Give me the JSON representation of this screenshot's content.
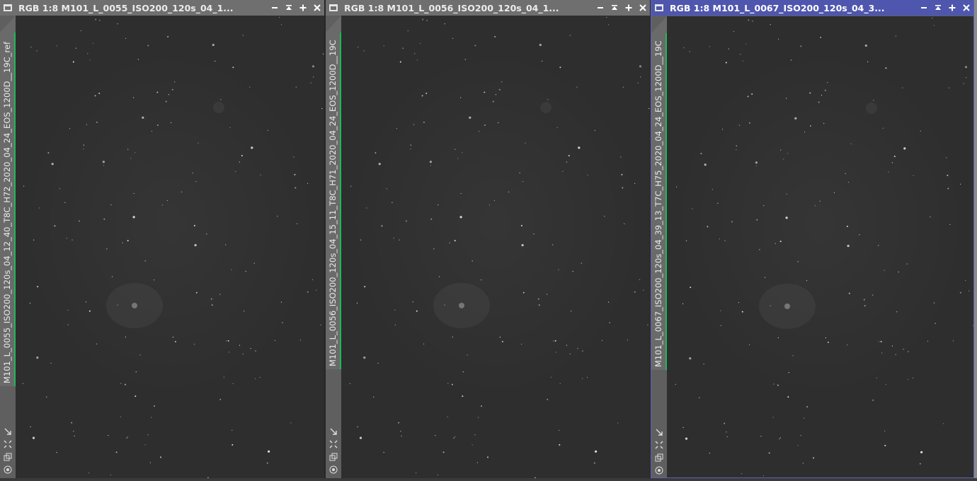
{
  "windows": [
    {
      "title": "RGB 1:8 M101_L_0055_ISO200_120s_04_1...",
      "side_label": "M101_L_0055_ISO200_120s_04_12_40_T8C_H72_2020_04_24_EOS_1200D__19C_ref",
      "active": false
    },
    {
      "title": "RGB 1:8 M101_L_0056_ISO200_120s_04_1...",
      "side_label": "M101_L_0056_ISO200_120s_04_15_11_T8C_H71_2020_04_24_EOS_1200D__19C",
      "active": false
    },
    {
      "title": "RGB 1:8 M101_L_0067_ISO200_120s_04_3...",
      "side_label": "M101_L_0067_ISO200_120s_04_39_13_T7C_H75_2020_04_24_EOS_1200D__19C",
      "active": true
    }
  ],
  "titlebar_buttons": [
    "minimize-icon",
    "shade-icon",
    "maximize-icon",
    "close-icon"
  ],
  "side_tools": [
    "fit-view-icon",
    "zoom-icon",
    "clone-icon",
    "target-icon"
  ],
  "colors": {
    "titlebar_inactive": "#6f6f6f",
    "titlebar_active": "#4f56ad",
    "sidebar_accent": "#1fb85a",
    "image_bg": "#2e2e2e"
  }
}
